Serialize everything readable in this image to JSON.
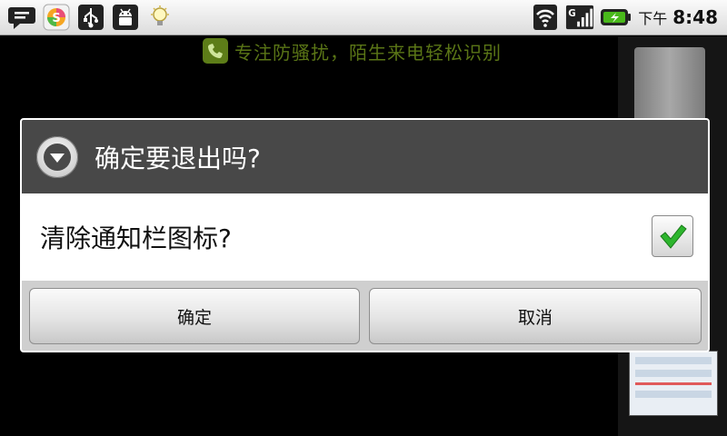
{
  "status_bar": {
    "left_icons": [
      "chat-bubble-icon",
      "app-store-icon",
      "usb-icon",
      "android-debug-icon",
      "lightbulb-icon"
    ],
    "right_icons": [
      "wifi-icon",
      "signal-icon",
      "battery-charging-icon"
    ],
    "signal_type": "G",
    "ampm": "下午",
    "time": "8:48"
  },
  "background_app": {
    "banner_text": "专注防骚扰，陌生来电轻松识别",
    "banner_icon": "phone-shield-icon"
  },
  "dialog": {
    "title": "确定要退出吗?",
    "title_icon": "chevron-down-circle-icon",
    "message": "清除通知栏图标?",
    "checkbox_checked": true,
    "buttons": {
      "ok": "确定",
      "cancel": "取消"
    }
  },
  "colors": {
    "title_bg": "#484848",
    "banner_green": "#6a8a1a",
    "check_green": "#2db52d",
    "battery_green": "#49b81b"
  }
}
